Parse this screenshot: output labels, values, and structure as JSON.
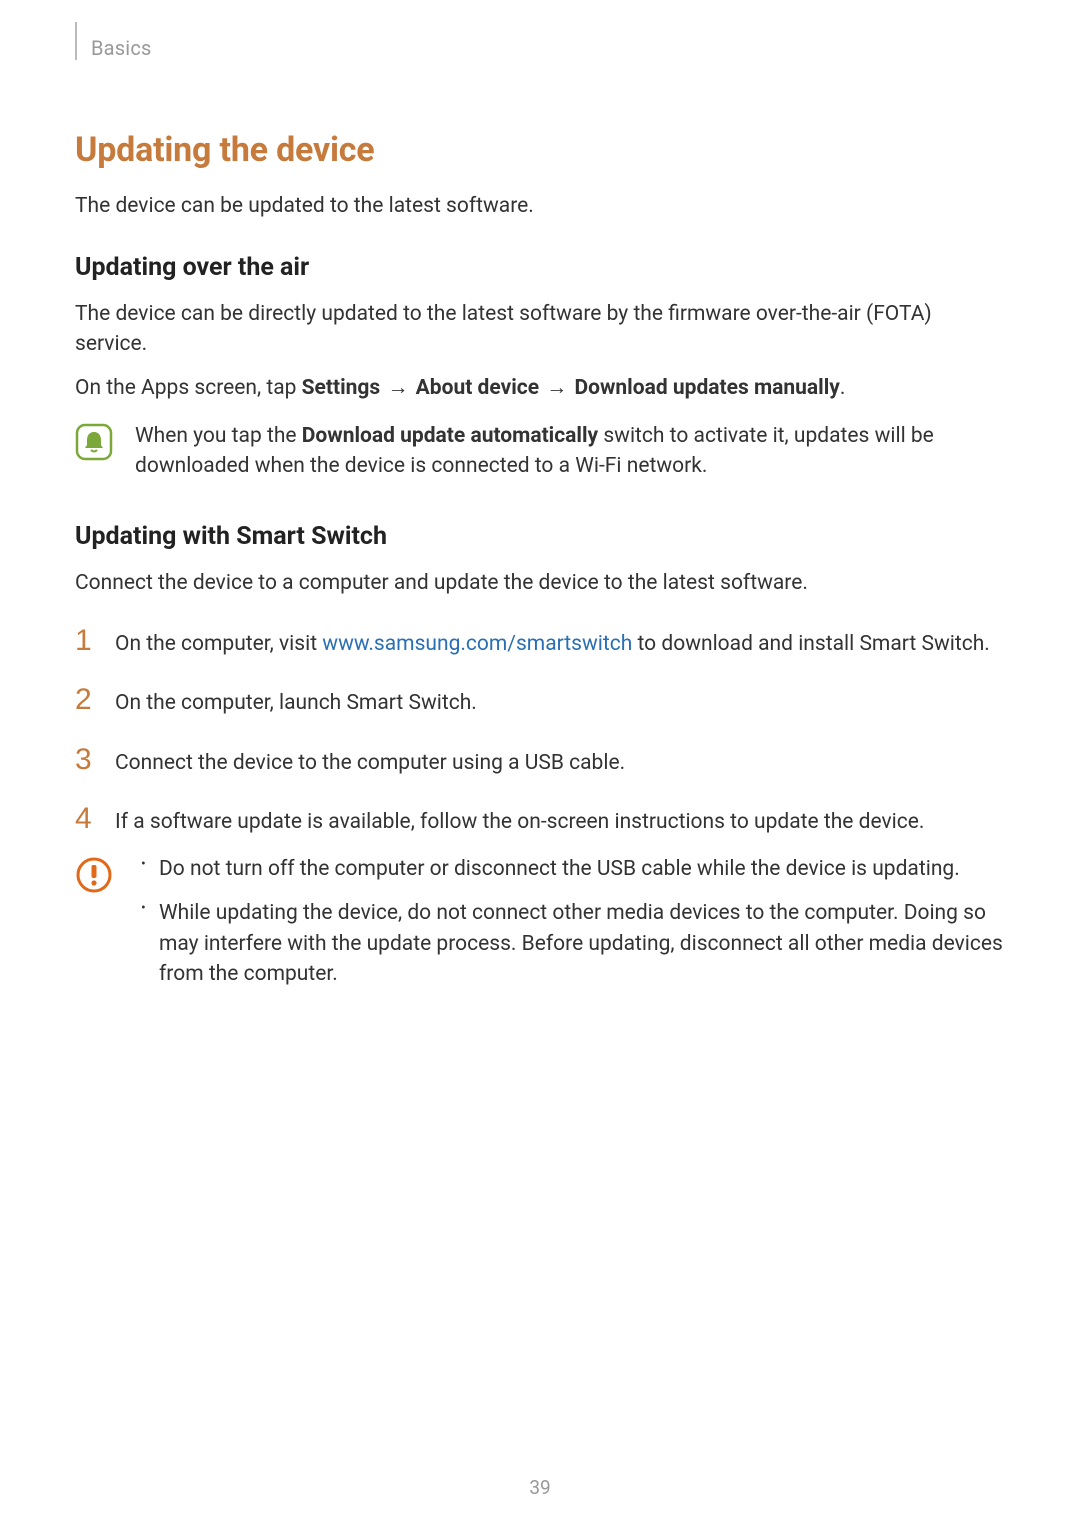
{
  "header": {
    "section": "Basics"
  },
  "title": "Updating the device",
  "intro": "The device can be updated to the latest software.",
  "ota": {
    "heading": "Updating over the air",
    "body": "The device can be directly updated to the latest software by the firmware over-the-air (FOTA) service.",
    "nav": {
      "prefix": "On the Apps screen, tap ",
      "step1": "Settings",
      "arrow": "→",
      "step2": "About device",
      "step3": "Download updates manually",
      "suffix": "."
    },
    "note": {
      "prefix": "When you tap the ",
      "bold": "Download update automatically",
      "suffix": " switch to activate it, updates will be downloaded when the device is connected to a Wi-Fi network."
    }
  },
  "smartswitch": {
    "heading": "Updating with Smart Switch",
    "intro": "Connect the device to a computer and update the device to the latest software.",
    "steps": {
      "s1": {
        "num": "1",
        "prefix": "On the computer, visit ",
        "link": "www.samsung.com/smartswitch",
        "suffix": " to download and install Smart Switch."
      },
      "s2": {
        "num": "2",
        "text": "On the computer, launch Smart Switch."
      },
      "s3": {
        "num": "3",
        "text": "Connect the device to the computer using a USB cable."
      },
      "s4": {
        "num": "4",
        "text": "If a software update is available, follow the on-screen instructions to update the device."
      }
    },
    "caution": {
      "b1": "Do not turn off the computer or disconnect the USB cable while the device is updating.",
      "b2": "While updating the device, do not connect other media devices to the computer. Doing so may interfere with the update process. Before updating, disconnect all other media devices from the computer."
    }
  },
  "page_number": "39"
}
